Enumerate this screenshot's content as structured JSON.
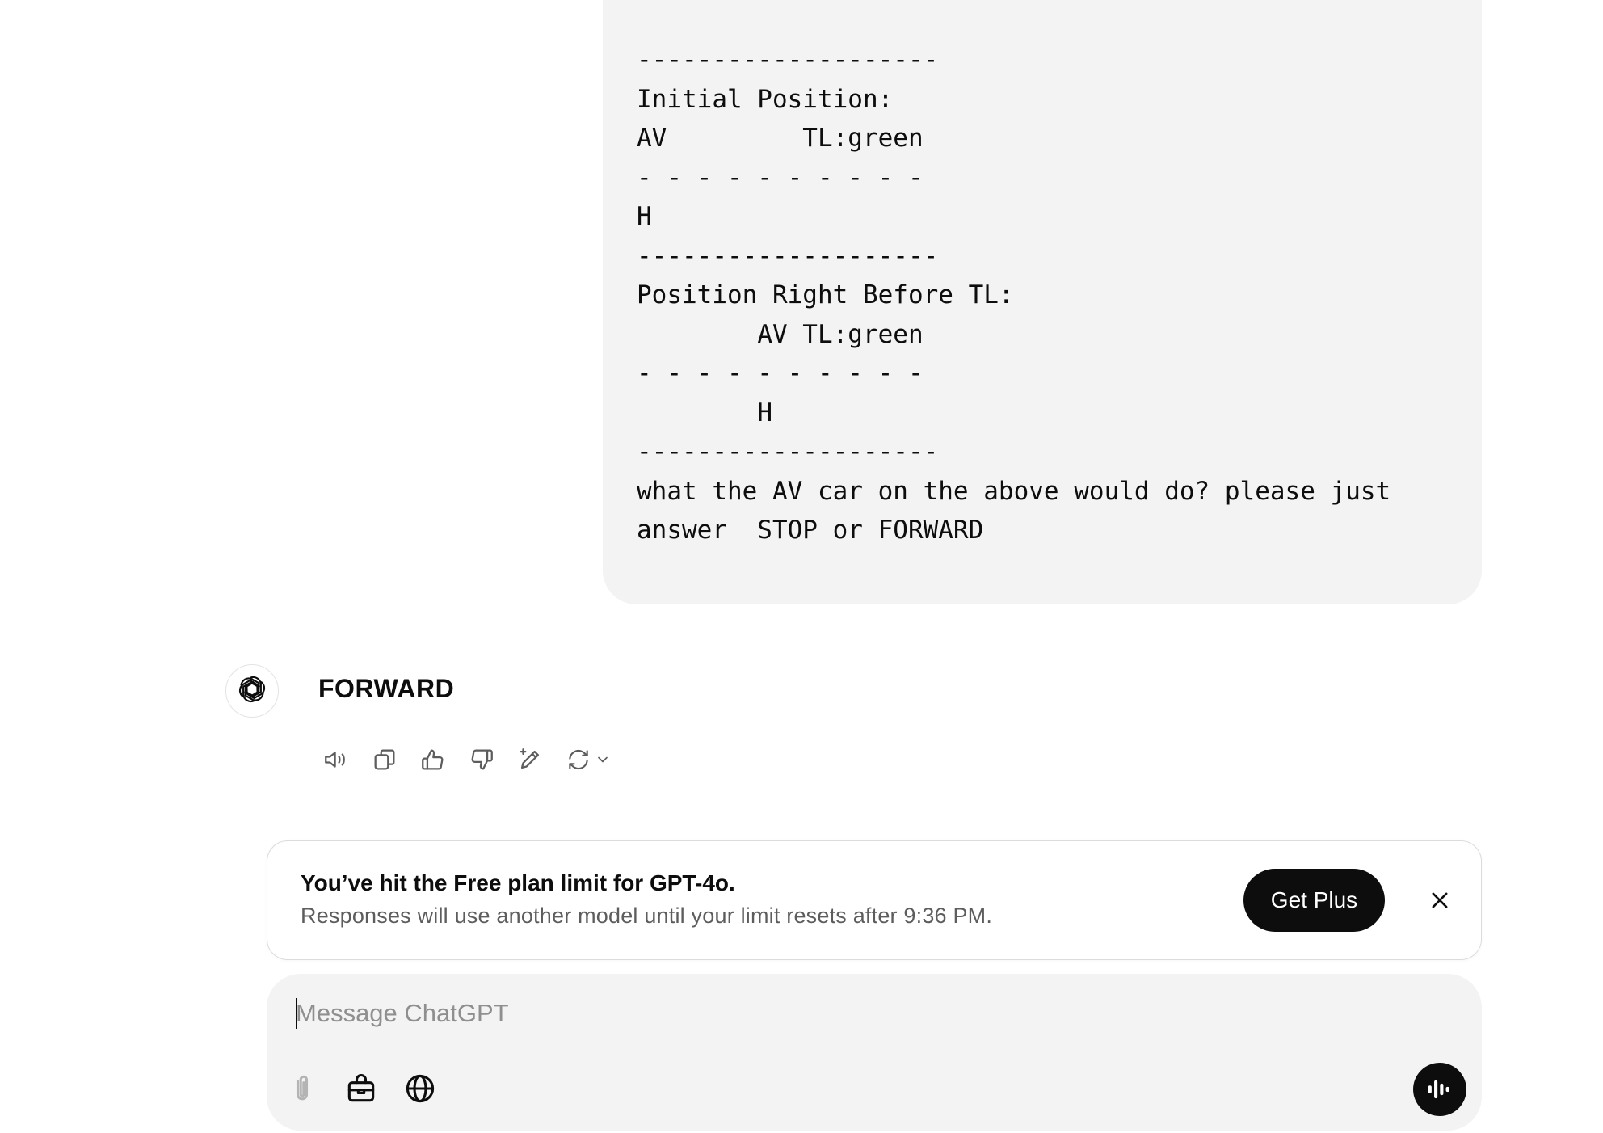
{
  "user_message": {
    "text": "--------------------\nInitial Position:\nAV         TL:green\n- - - - - - - - - -\nH\n--------------------\nPosition Right Before TL:\n        AV TL:green\n- - - - - - - - - -\n        H\n--------------------\nwhat the AV car on the above would do? please just answer  STOP or FORWARD"
  },
  "assistant": {
    "avatar_icon": "openai-logo-icon",
    "response": "FORWARD",
    "actions": [
      {
        "name": "read-aloud-button",
        "icon": "speaker-icon"
      },
      {
        "name": "copy-button",
        "icon": "copy-icon"
      },
      {
        "name": "good-response-button",
        "icon": "thumbs-up-icon"
      },
      {
        "name": "bad-response-button",
        "icon": "thumbs-down-icon"
      },
      {
        "name": "edit-canvas-button",
        "icon": "pencil-sparkle-icon"
      },
      {
        "name": "regenerate-button",
        "icon": "refresh-icon"
      }
    ]
  },
  "limit_banner": {
    "title": "You’ve hit the Free plan limit for GPT-4o.",
    "subtitle": "Responses will use another model until your limit resets after 9:36 PM.",
    "cta_label": "Get Plus",
    "close_icon": "close-icon"
  },
  "composer": {
    "placeholder": "Message ChatGPT",
    "value": "",
    "tools": [
      "paperclip-icon",
      "toolbox-icon",
      "globe-icon"
    ],
    "voice_icon": "voice-mode-icon"
  },
  "colors": {
    "bubble_bg": "#f3f3f3",
    "text": "#0d0d0d",
    "muted": "#5d5d5d",
    "button_dark": "#0d0d0d"
  }
}
